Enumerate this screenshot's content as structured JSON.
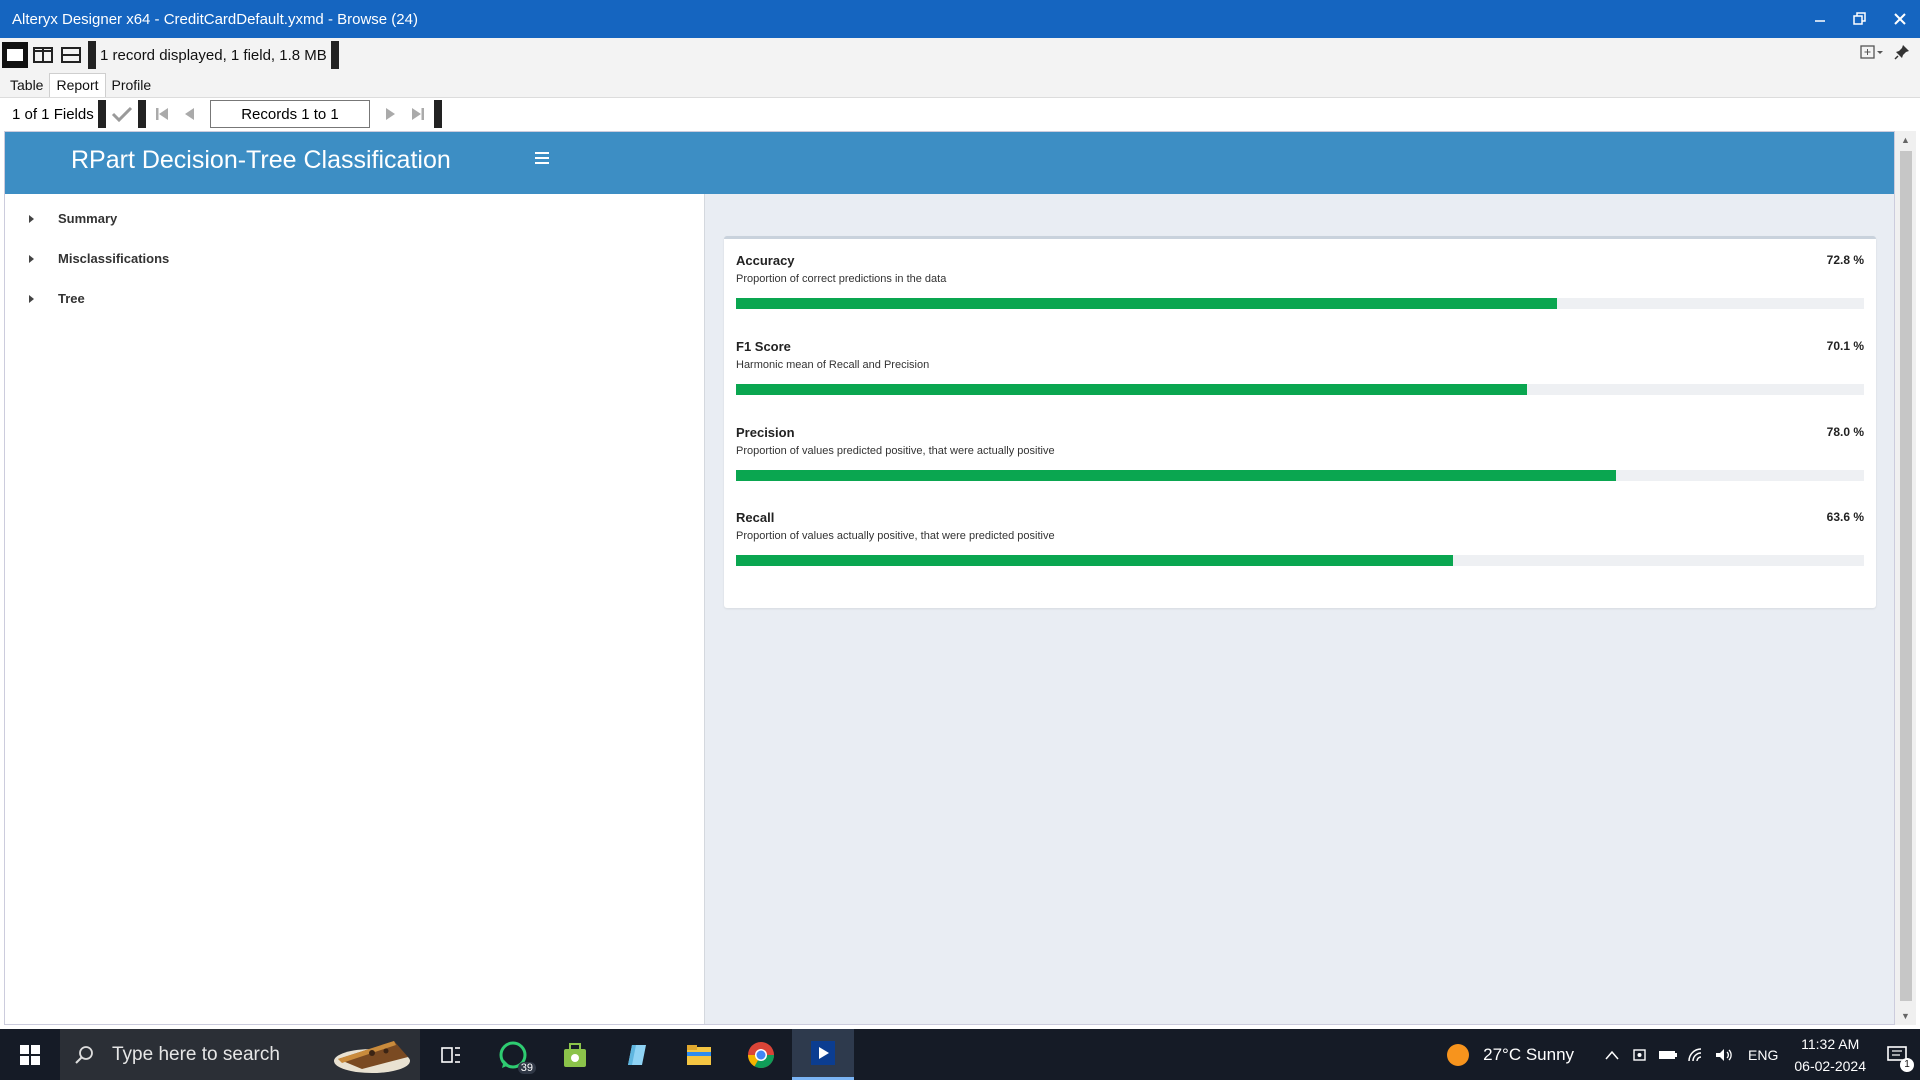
{
  "window": {
    "title": "Alteryx Designer x64 - CreditCardDefault.yxmd - Browse (24)",
    "minimize": "–",
    "restore": "❐",
    "close": "✕"
  },
  "infobar": {
    "status": "1 record displayed, 1 field, 1.8 MB"
  },
  "tabs": [
    {
      "label": "Table"
    },
    {
      "label": "Report"
    },
    {
      "label": "Profile"
    }
  ],
  "active_tab": "Report",
  "recnav": {
    "fields": "1 of 1 Fields",
    "records": "Records 1 to 1"
  },
  "report": {
    "title": "RPart Decision-Tree Classification",
    "sidebar": [
      {
        "label": "Summary"
      },
      {
        "label": "Misclassifications"
      },
      {
        "label": "Tree"
      }
    ],
    "metrics": [
      {
        "name": "Accuracy",
        "value_text": "72.8 %",
        "value": 0.728,
        "desc": "Proportion of correct predictions in the data"
      },
      {
        "name": "F1 Score",
        "value_text": "70.1 %",
        "value": 0.701,
        "desc": "Harmonic mean of Recall and Precision"
      },
      {
        "name": "Precision",
        "value_text": "78.0 %",
        "value": 0.78,
        "desc": "Proportion of values predicted positive, that were actually positive"
      },
      {
        "name": "Recall",
        "value_text": "63.6 %",
        "value": 0.636,
        "desc": "Proportion of values actually positive, that were predicted positive"
      }
    ],
    "colors": {
      "header": "#3d8ec4",
      "bar": "#0aa650"
    }
  },
  "taskbar": {
    "search_placeholder": "Type here to search",
    "whatsapp_badge": "39",
    "weather": "27°C  Sunny",
    "language": "ENG",
    "time": "11:32 AM",
    "date": "06-02-2024",
    "notifications": "1",
    "icons": [
      "windows-icon",
      "search-icon",
      "task-view-icon",
      "whatsapp-icon",
      "store-icon",
      "edit-icon",
      "file-explorer-icon",
      "chrome-icon",
      "alteryx-icon"
    ]
  }
}
